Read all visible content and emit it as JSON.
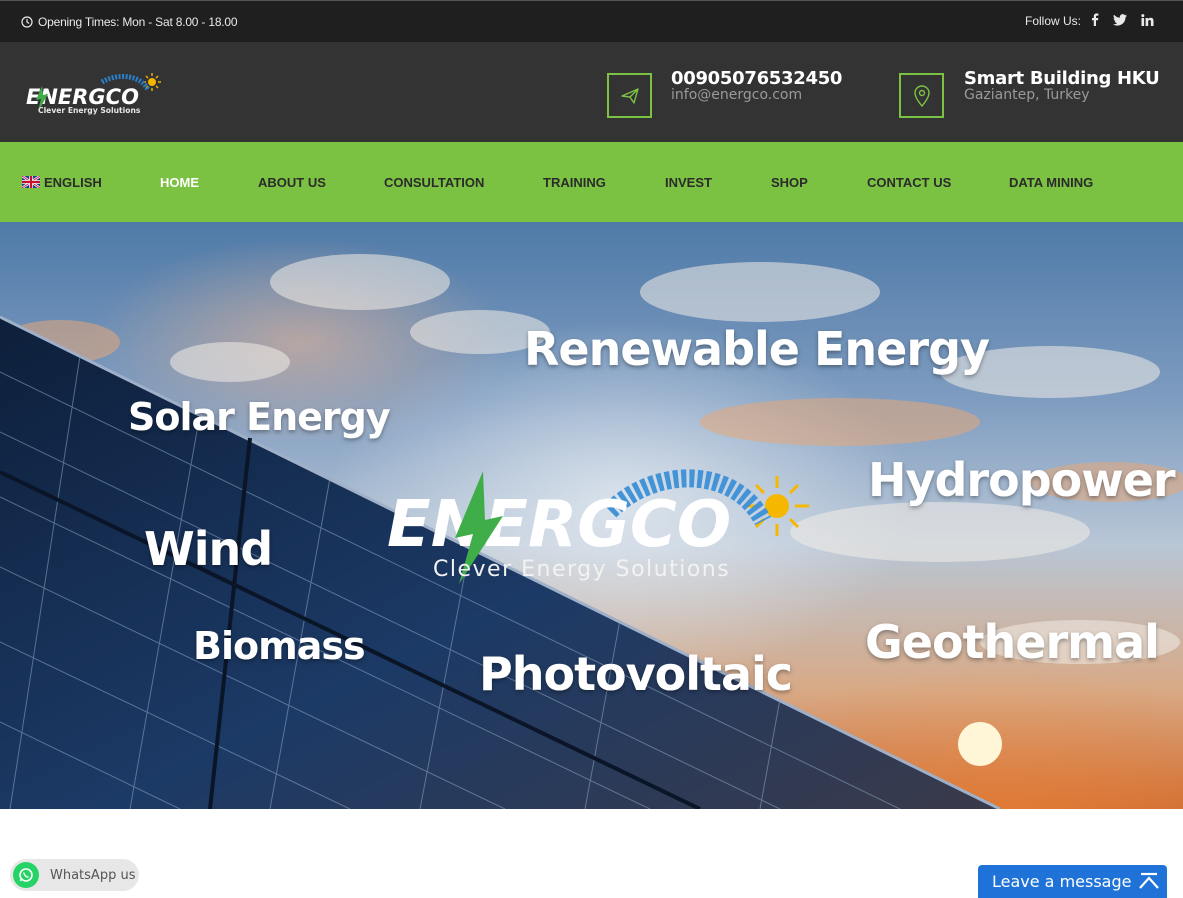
{
  "topbar": {
    "opening_times": "Opening Times: Mon - Sat 8.00 - 18.00",
    "follow_label": "Follow Us:",
    "social": [
      {
        "icon": "facebook-icon",
        "glyph": "f"
      },
      {
        "icon": "twitter-icon",
        "glyph": "🐦"
      },
      {
        "icon": "linkedin-icon",
        "glyph": "in"
      }
    ]
  },
  "brand": {
    "logo_text": "ENERGCO",
    "logo_tagline": "Clever Energy Solutions",
    "accent_color": "#7cc242"
  },
  "header": {
    "phone": "00905076532450",
    "email": "info@energco.com",
    "location_title": "Smart Building HKU",
    "location_sub": "Gaziantep, Turkey"
  },
  "nav": {
    "items": [
      {
        "label": "ENGLISH",
        "active": false
      },
      {
        "label": "HOME",
        "active": true
      },
      {
        "label": "ABOUT US",
        "active": false
      },
      {
        "label": "CONSULTATION",
        "active": false
      },
      {
        "label": "TRAINING",
        "active": false
      },
      {
        "label": "INVEST",
        "active": false
      },
      {
        "label": "SHOP",
        "active": false
      },
      {
        "label": "CONTACT US",
        "active": false
      },
      {
        "label": "DATA MINING",
        "active": false
      }
    ]
  },
  "hero": {
    "words": {
      "renewable": "Renewable Energy",
      "solar": "Solar Energy",
      "hydro": "Hydropower",
      "wind": "Wind",
      "biomass": "Biomass",
      "geothermal": "Geothermal",
      "photovoltaic": "Photovoltaic"
    },
    "logo_text": "ENERGCO",
    "logo_tagline": "Clever Energy Solutions"
  },
  "widgets": {
    "whatsapp_label": "WhatsApp us",
    "leave_message": "Leave a message"
  }
}
